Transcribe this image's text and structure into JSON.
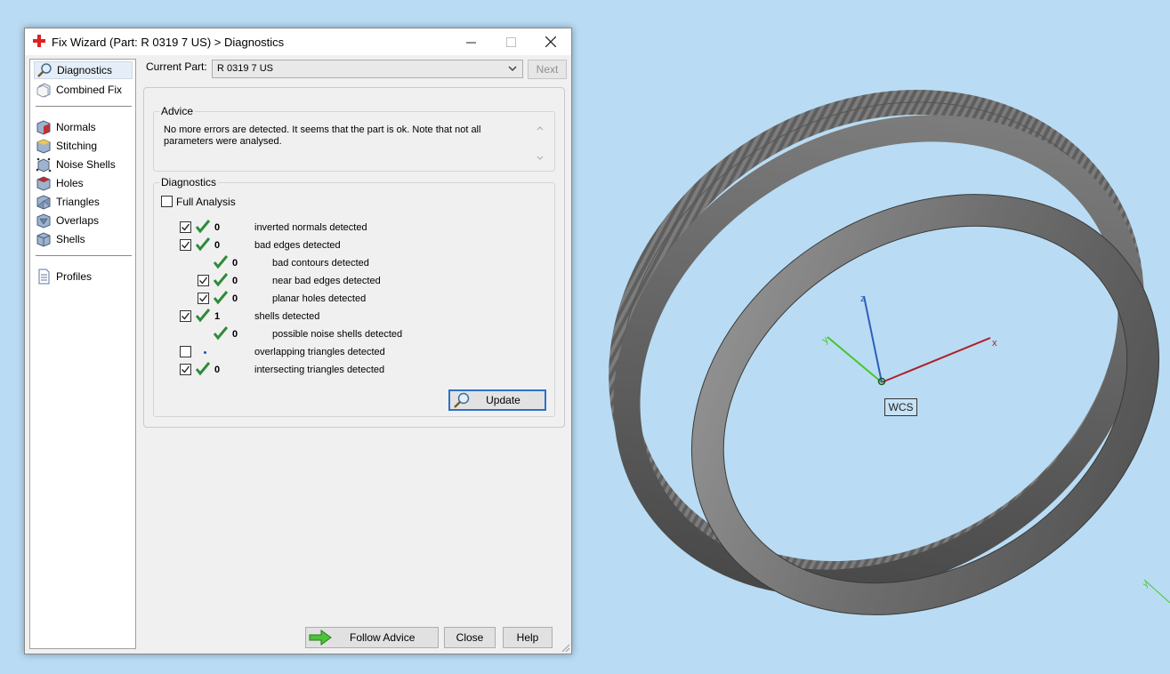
{
  "window": {
    "title": "Fix Wizard (Part: R 0319 7 US) > Diagnostics",
    "minimize": "–",
    "maximize": "☐",
    "close": "✕"
  },
  "sidebar": {
    "items": [
      {
        "label": "Diagnostics",
        "icon": "magnifier-icon",
        "active": true
      },
      {
        "label": "Combined Fix",
        "icon": "combined-fix-icon"
      },
      {
        "label": "Normals",
        "icon": "normals-icon"
      },
      {
        "label": "Stitching",
        "icon": "stitching-icon"
      },
      {
        "label": "Noise Shells",
        "icon": "noise-shells-icon"
      },
      {
        "label": "Holes",
        "icon": "holes-icon"
      },
      {
        "label": "Triangles",
        "icon": "triangles-icon"
      },
      {
        "label": "Overlaps",
        "icon": "overlaps-icon"
      },
      {
        "label": "Shells",
        "icon": "shells-icon"
      },
      {
        "label": "Profiles",
        "icon": "profiles-icon"
      }
    ]
  },
  "current_part": {
    "label": "Current Part:",
    "value": "R 0319 7 US",
    "next_label": "Next"
  },
  "advice": {
    "title": "Advice",
    "text": "No more errors are detected. It seems that the part is ok. Note that not all parameters were analysed."
  },
  "diagnostics": {
    "title": "Diagnostics",
    "full_analysis_label": "Full Analysis",
    "rows": [
      {
        "checked": true,
        "status": "ok",
        "count": "0",
        "label": "inverted normals detected"
      },
      {
        "checked": true,
        "status": "ok",
        "count": "0",
        "label": "bad edges detected"
      },
      {
        "checked": null,
        "status": "ok",
        "count": "0",
        "label": "bad contours detected"
      },
      {
        "checked": true,
        "status": "ok",
        "count": "0",
        "label": "near bad edges detected"
      },
      {
        "checked": true,
        "status": "ok",
        "count": "0",
        "label": "planar holes detected"
      },
      {
        "checked": true,
        "status": "ok",
        "count": "1",
        "label": "shells detected"
      },
      {
        "checked": null,
        "status": "ok",
        "count": "0",
        "label": "possible noise shells detected"
      },
      {
        "checked": false,
        "status": "pending",
        "count": "",
        "label": "overlapping triangles detected"
      },
      {
        "checked": true,
        "status": "ok",
        "count": "0",
        "label": "intersecting triangles detected"
      }
    ],
    "update_label": "Update"
  },
  "footer": {
    "follow_advice_label": "Follow Advice",
    "close_label": "Close",
    "help_label": "Help"
  },
  "viewport": {
    "wcs_label": "WCS",
    "axis_x": "x",
    "axis_y": "y",
    "axis_z": "z"
  },
  "colors": {
    "viewport_bg": "#b9dcf4",
    "check_green": "#2e8b3a",
    "axis_x": "#b0202a",
    "axis_y": "#48c52a",
    "axis_z": "#2f5fb8"
  }
}
